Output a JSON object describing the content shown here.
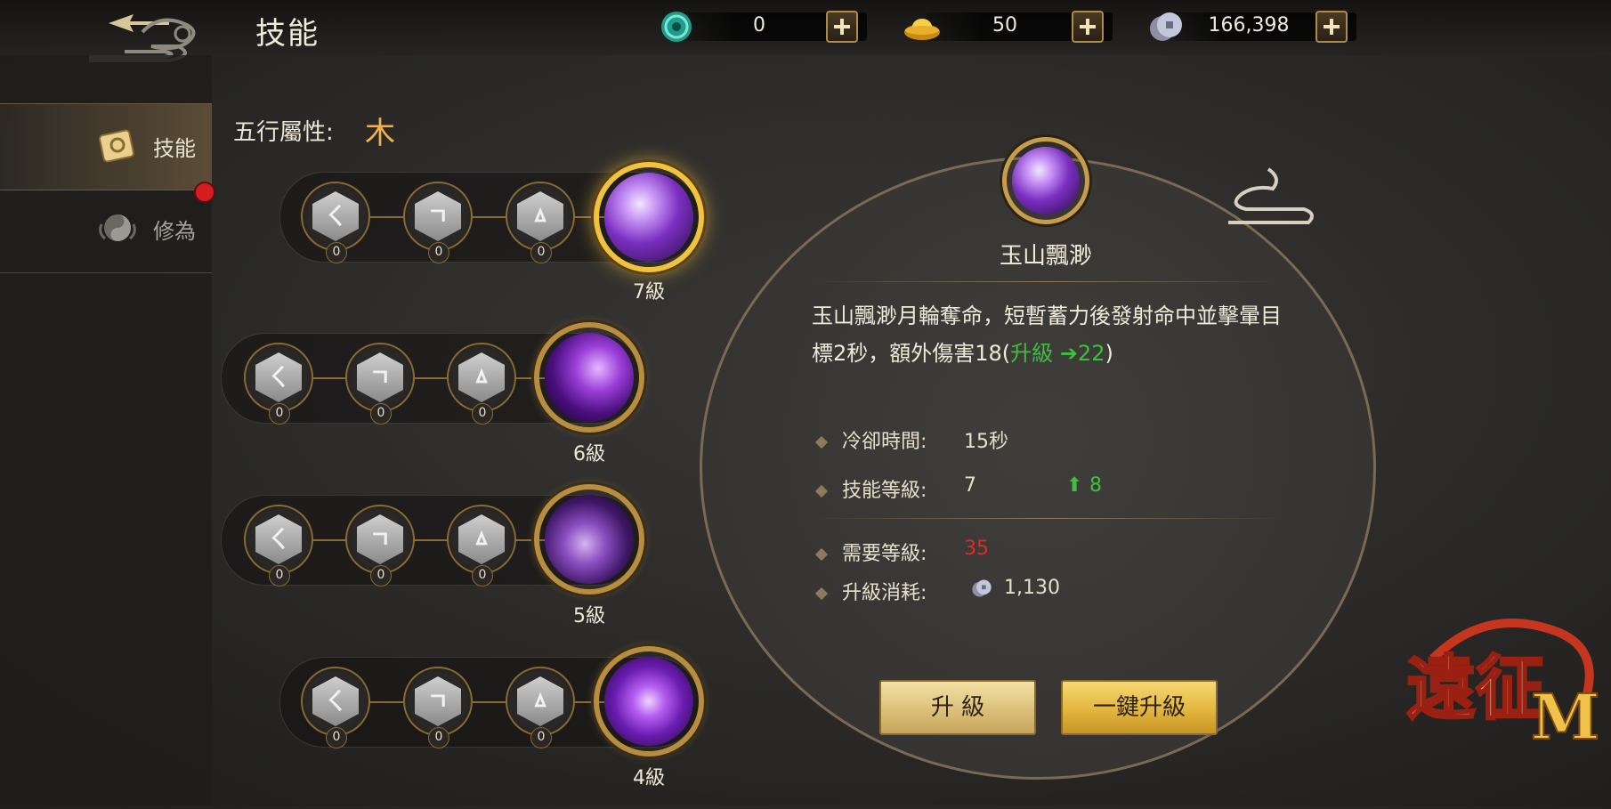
{
  "header": {
    "title": "技能",
    "currencies": [
      {
        "name": "jade",
        "value": "0",
        "icon": "jade-icon"
      },
      {
        "name": "gold-ingot",
        "value": "50",
        "icon": "gold-ingot-icon"
      },
      {
        "name": "silver-coin",
        "value": "166,398",
        "icon": "silver-coin-icon"
      }
    ]
  },
  "sidebar": {
    "items": [
      {
        "label": "技能",
        "active": true
      },
      {
        "label": "修為",
        "active": false
      }
    ]
  },
  "element": {
    "label": "五行屬性:",
    "value": "木"
  },
  "skills": [
    {
      "level": "7級",
      "nodes": [
        {
          "glyph": "ㄑ",
          "count": "0"
        },
        {
          "glyph": "ㄱ",
          "count": "0"
        },
        {
          "glyph": "ㅿ",
          "count": "0"
        }
      ],
      "selected": true
    },
    {
      "level": "6級",
      "nodes": [
        {
          "glyph": "ㄑ",
          "count": "0"
        },
        {
          "glyph": "ㄱ",
          "count": "0"
        },
        {
          "glyph": "ㅿ",
          "count": "0"
        }
      ],
      "selected": false
    },
    {
      "level": "5級",
      "nodes": [
        {
          "glyph": "ㄑ",
          "count": "0"
        },
        {
          "glyph": "ㄱ",
          "count": "0"
        },
        {
          "glyph": "ㅿ",
          "count": "0"
        }
      ],
      "selected": false
    },
    {
      "level": "4級",
      "nodes": [
        {
          "glyph": "ㄑ",
          "count": "0"
        },
        {
          "glyph": "ㄱ",
          "count": "0"
        },
        {
          "glyph": "ㅿ",
          "count": "0"
        }
      ],
      "selected": false
    }
  ],
  "detail": {
    "name": "玉山飄渺",
    "desc_main": "玉山飄渺月輪奪命，短暫蓄力後發射命中並擊暈目標2秒，額外傷害18(",
    "desc_upgrade": "升級",
    "desc_arrow": "➔",
    "desc_new": "22",
    "desc_close": ")",
    "cooldown_label": "冷卻時間:",
    "cooldown_value": "15秒",
    "skill_level_label": "技能等級:",
    "skill_level_value": "7",
    "skill_level_next": "8",
    "required_level_label": "需要等級:",
    "required_level_value": "35",
    "cost_label": "升級消耗:",
    "cost_value": "1,130"
  },
  "buttons": {
    "upgrade": "升 級",
    "oneclick": "一鍵升級"
  },
  "logo": {
    "text": "遠征",
    "suffix": "M"
  },
  "colors": {
    "accent": "#c79d49",
    "green": "#3fbf3f",
    "red": "#e02a2a"
  }
}
